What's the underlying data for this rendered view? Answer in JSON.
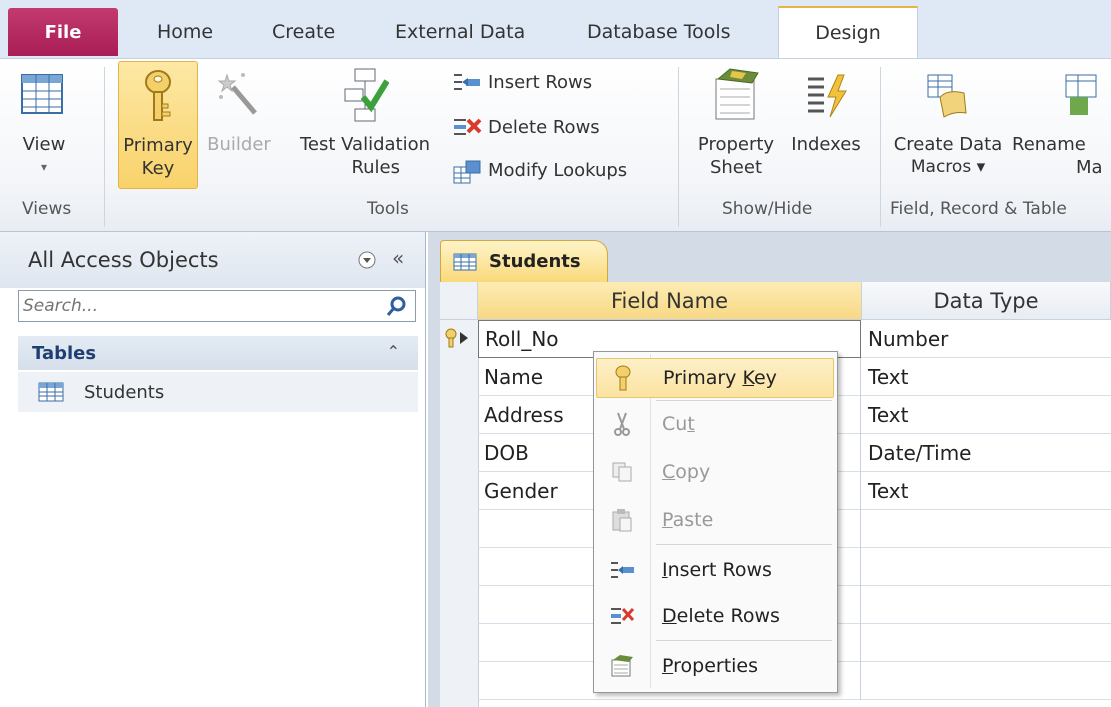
{
  "tabs": [
    {
      "label": "File"
    },
    {
      "label": "Home"
    },
    {
      "label": "Create"
    },
    {
      "label": "External Data"
    },
    {
      "label": "Database Tools"
    },
    {
      "label": "Design"
    }
  ],
  "ribbon": {
    "view": {
      "label": "View",
      "arrow": "▾",
      "group": "Views"
    },
    "primary_key": {
      "line1": "Primary",
      "line2": "Key"
    },
    "builder": {
      "label": "Builder"
    },
    "test_validation": {
      "line1": "Test Validation",
      "line2": "Rules"
    },
    "insert_rows": "Insert Rows",
    "delete_rows": "Delete Rows",
    "modify_lookups": "Modify Lookups",
    "tools_group": "Tools",
    "property_sheet": {
      "line1": "Property",
      "line2": "Sheet"
    },
    "indexes": "Indexes",
    "showhide_group": "Show/Hide",
    "create_macros": {
      "line1": "Create Data",
      "line2": "Macros ▾"
    },
    "rename_macro": {
      "line1": "Rename",
      "line2": "Ma"
    },
    "field_record_group": "Field, Record & Table"
  },
  "nav": {
    "title": "All Access Objects",
    "search_placeholder": "Search...",
    "group": "Tables",
    "items": [
      {
        "label": "Students"
      }
    ]
  },
  "document": {
    "tab": "Students",
    "headers": {
      "field_name": "Field Name",
      "data_type": "Data Type"
    },
    "rows": [
      {
        "field": "Roll_No",
        "type": "Number"
      },
      {
        "field": "Name",
        "type": "Text"
      },
      {
        "field": "Address",
        "type": "Text"
      },
      {
        "field": "DOB",
        "type": "Date/Time"
      },
      {
        "field": "Gender",
        "type": "Text"
      }
    ]
  },
  "context_menu": {
    "primary_key": {
      "pre": "Primary ",
      "acc": "K",
      "post": "ey"
    },
    "cut": {
      "pre": "Cu",
      "acc": "t",
      "post": ""
    },
    "copy": {
      "pre": "",
      "acc": "C",
      "post": "opy"
    },
    "paste": {
      "pre": "",
      "acc": "P",
      "post": "aste"
    },
    "insert_rows": {
      "pre": "",
      "acc": "I",
      "post": "nsert Rows"
    },
    "delete_rows": {
      "pre": "",
      "acc": "D",
      "post": "elete Rows"
    },
    "properties": {
      "pre": "",
      "acc": "P",
      "post": "roperties"
    }
  },
  "colors": {
    "file_tab": "#b22a62",
    "highlight": "#f9d26a",
    "accent": "#e3b449"
  }
}
